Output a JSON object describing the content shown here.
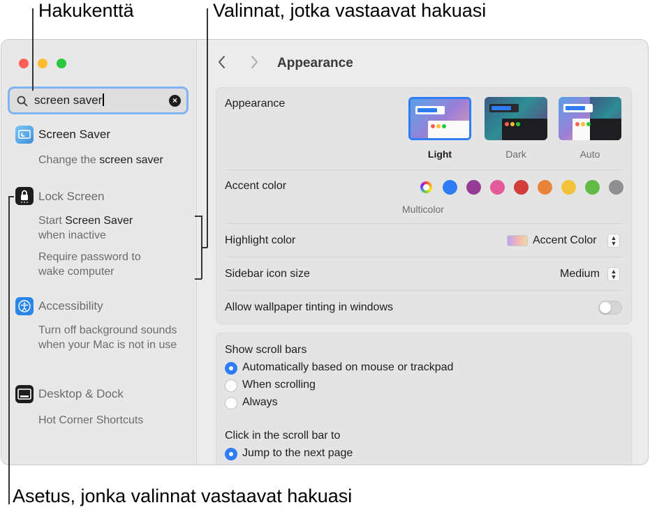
{
  "callouts": {
    "search_field": "Hakukenttä",
    "matching_options": "Valinnat, jotka vastaavat hakuasi",
    "matching_setting": "Asetus, jonka valinnat vastaavat hakuasi"
  },
  "window": {
    "traffic_lights": [
      "#ff5f57",
      "#febc2e",
      "#28c840"
    ]
  },
  "search": {
    "value": "screen saver",
    "clear_icon": "xmark-circle-icon"
  },
  "sidebar": {
    "results": [
      {
        "title": "Screen Saver",
        "icon": "screen-saver-icon",
        "options": [
          "Change the screen saver"
        ]
      },
      {
        "title": "Lock Screen",
        "icon": "lock-icon",
        "options": [
          "Start Screen Saver when inactive",
          "Require password to wake computer"
        ]
      },
      {
        "title": "Accessibility",
        "icon": "accessibility-icon",
        "options": [
          "Turn off background sounds when your Mac is not in use"
        ]
      },
      {
        "title": "Desktop & Dock",
        "icon": "desktop-dock-icon",
        "options": [
          "Hot Corner Shortcuts"
        ]
      }
    ]
  },
  "nav": {
    "back_icon": "chevron-left-icon",
    "forward_icon": "chevron-right-icon",
    "title": "Appearance"
  },
  "appearance": {
    "label": "Appearance",
    "options": [
      {
        "label": "Light",
        "selected": true
      },
      {
        "label": "Dark",
        "selected": false
      },
      {
        "label": "Auto",
        "selected": false
      }
    ]
  },
  "accent_color": {
    "label": "Accent color",
    "selected_label": "Multicolor",
    "colors": [
      "multicolor",
      "#2e7cf6",
      "#953d96",
      "#e45b9c",
      "#d13d39",
      "#e8833a",
      "#f3c23a",
      "#62ba46",
      "#8e8e93"
    ]
  },
  "highlight_color": {
    "label": "Highlight color",
    "value": "Accent Color"
  },
  "sidebar_icon_size": {
    "label": "Sidebar icon size",
    "value": "Medium"
  },
  "wallpaper_tinting": {
    "label": "Allow wallpaper tinting in windows",
    "on": false
  },
  "scroll_bars": {
    "label": "Show scroll bars",
    "options": [
      {
        "label": "Automatically based on mouse or trackpad",
        "selected": true
      },
      {
        "label": "When scrolling",
        "selected": false
      },
      {
        "label": "Always",
        "selected": false
      }
    ]
  },
  "click_scroll": {
    "label": "Click in the scroll bar to",
    "options": [
      {
        "label": "Jump to the next page",
        "selected": true
      }
    ]
  }
}
